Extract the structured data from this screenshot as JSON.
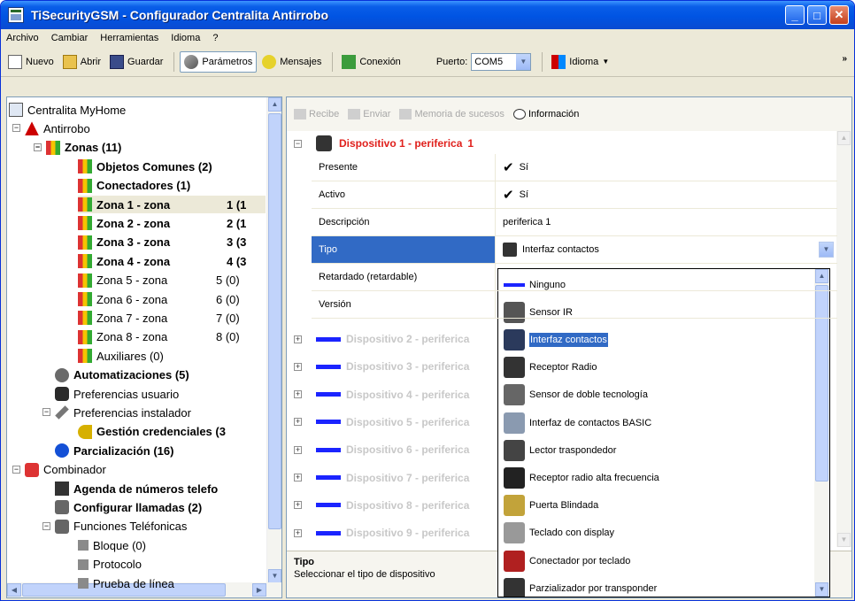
{
  "window": {
    "title": "TiSecurityGSM - Configurador Centralita Antirrobo"
  },
  "menu": [
    "Archivo",
    "Cambiar",
    "Herramientas",
    "Idioma",
    "?"
  ],
  "toolbar": {
    "nuevo": "Nuevo",
    "abrir": "Abrir",
    "guardar": "Guardar",
    "parametros": "Parámetros",
    "mensajes": "Mensajes",
    "conexion": "Conexión",
    "puerto_label": "Puerto:",
    "puerto_value": "COM5",
    "idioma": "Idioma",
    "overflow": "»"
  },
  "tree": [
    {
      "label": "Centralita MyHome",
      "count": "",
      "bold": false
    },
    {
      "label": "Antirrobo",
      "count": "",
      "bold": false
    },
    {
      "label": "Zonas (11)",
      "count": "",
      "bold": true
    },
    {
      "label": "Objetos Comunes (2)",
      "count": "",
      "bold": true
    },
    {
      "label": "Conectadores (1)",
      "count": "",
      "bold": true
    },
    {
      "label": "Zona 1 - zona",
      "count": "1 (1",
      "bold": true
    },
    {
      "label": "Zona 2 - zona",
      "count": "2 (1",
      "bold": true
    },
    {
      "label": "Zona 3 - zona",
      "count": "3 (3",
      "bold": true
    },
    {
      "label": "Zona 4 - zona",
      "count": "4 (3",
      "bold": true
    },
    {
      "label": "Zona 5 - zona",
      "count": "5 (0)",
      "bold": false
    },
    {
      "label": "Zona 6 - zona",
      "count": "6 (0)",
      "bold": false
    },
    {
      "label": "Zona 7 - zona",
      "count": "7 (0)",
      "bold": false
    },
    {
      "label": "Zona 8 - zona",
      "count": "8 (0)",
      "bold": false
    },
    {
      "label": "Auxiliares (0)",
      "count": "",
      "bold": false
    },
    {
      "label": "Automatizaciones (5)",
      "count": "",
      "bold": true
    },
    {
      "label": "Preferencias usuario",
      "count": "",
      "bold": false
    },
    {
      "label": "Preferencias instalador",
      "count": "",
      "bold": false
    },
    {
      "label": "Gestión credenciales (3",
      "count": "",
      "bold": true
    },
    {
      "label": "Parcialización (16)",
      "count": "",
      "bold": true
    },
    {
      "label": "Combinador",
      "count": "",
      "bold": false
    },
    {
      "label": "Agenda de números telefo",
      "count": "",
      "bold": true
    },
    {
      "label": "Configurar llamadas (2)",
      "count": "",
      "bold": true
    },
    {
      "label": "Funciones Teléfonicas",
      "count": "",
      "bold": false
    },
    {
      "label": "Bloque (0)",
      "count": "",
      "bold": false
    },
    {
      "label": "Protocolo",
      "count": "",
      "bold": false
    },
    {
      "label": "Prueba de línea",
      "count": "",
      "bold": false
    }
  ],
  "right_toolbar": {
    "recibe": "Recibe",
    "enviar": "Enviar",
    "memoria": "Memoria de sucesos",
    "informacion": "Información"
  },
  "device1": {
    "title": "Dispositivo 1 - periferica",
    "num": "1",
    "rows": [
      {
        "k": "Presente",
        "v": "Sí",
        "check": true
      },
      {
        "k": "Activo",
        "v": "Sí",
        "check": true
      },
      {
        "k": "Descripción",
        "v": "periferica  1",
        "check": false
      },
      {
        "k": "Tipo",
        "v": "Interfaz contactos",
        "check": false
      },
      {
        "k": "Retardado (retardable)",
        "v": "",
        "check": false
      },
      {
        "k": "Versión",
        "v": "",
        "check": false
      }
    ]
  },
  "other_devices": [
    "Dispositivo 2 - periferica",
    "Dispositivo 3 - periferica",
    "Dispositivo 4 - periferica",
    "Dispositivo 5 - periferica",
    "Dispositivo 6 - periferica",
    "Dispositivo 7 - periferica",
    "Dispositivo 8 - periferica",
    "Dispositivo 9 - periferica"
  ],
  "tipo_options": [
    "Ninguno",
    "Sensor IR",
    "Interfaz contactos",
    "Receptor Radio",
    "Sensor de doble tecnología",
    "Interfaz de contactos BASIC",
    "Lector traspondedor",
    "Receptor radio alta frecuencia",
    "Puerta Blindada",
    "Teclado con display",
    "Conectador por teclado",
    "Parzializador por transponder"
  ],
  "help": {
    "title": "Tipo",
    "text": "Seleccionar el tipo de dispositivo"
  },
  "colors": {
    "titlebar": "#0054e3",
    "selection": "#316ac5",
    "device_red": "#e0201c",
    "device_bar": "#1b24ff"
  }
}
